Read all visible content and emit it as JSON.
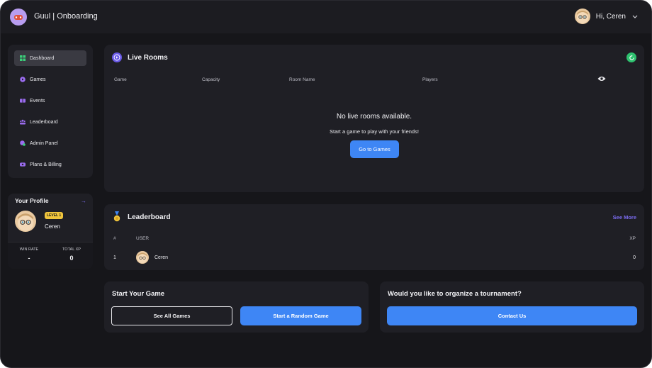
{
  "app": {
    "title": "Guul | Onboarding"
  },
  "header": {
    "greeting": "Hi, Ceren"
  },
  "sidebar": {
    "items": [
      {
        "label": "Dashboard",
        "icon": "dashboard-icon",
        "active": true
      },
      {
        "label": "Games",
        "icon": "games-icon"
      },
      {
        "label": "Events",
        "icon": "events-icon"
      },
      {
        "label": "Leaderboard",
        "icon": "leaderboard-icon"
      },
      {
        "label": "Admin Panel",
        "icon": "admin-icon"
      },
      {
        "label": "Plans & Billing",
        "icon": "billing-icon"
      }
    ]
  },
  "profile": {
    "title": "Your Profile",
    "level": "LEVEL 1",
    "name": "Ceren",
    "win_rate_label": "WIN RATE",
    "win_rate_value": "-",
    "total_xp_label": "TOTAL XP",
    "total_xp_value": "0"
  },
  "live_rooms": {
    "title": "Live Rooms",
    "columns": [
      "Game",
      "Capacity",
      "Room Name",
      "Players"
    ],
    "empty_title": "No live rooms available.",
    "empty_subtitle": "Start a game to play with your friends!",
    "go_button": "Go to Games"
  },
  "leaderboard": {
    "title": "Leaderboard",
    "see_more": "See More",
    "columns": {
      "rank": "#",
      "user": "USER",
      "xp": "XP"
    },
    "rows": [
      {
        "rank": "1",
        "user": "Ceren",
        "xp": "0"
      }
    ]
  },
  "start_game": {
    "title": "Start Your Game",
    "see_all": "See All Games",
    "random": "Start a Random Game"
  },
  "tournament": {
    "title": "Would you like to organize a tournament?",
    "contact": "Contact Us"
  },
  "colors": {
    "accent": "#3e86f5",
    "purple": "#6a5ae8",
    "green": "#2ec16f",
    "badge": "#f0c53c"
  }
}
